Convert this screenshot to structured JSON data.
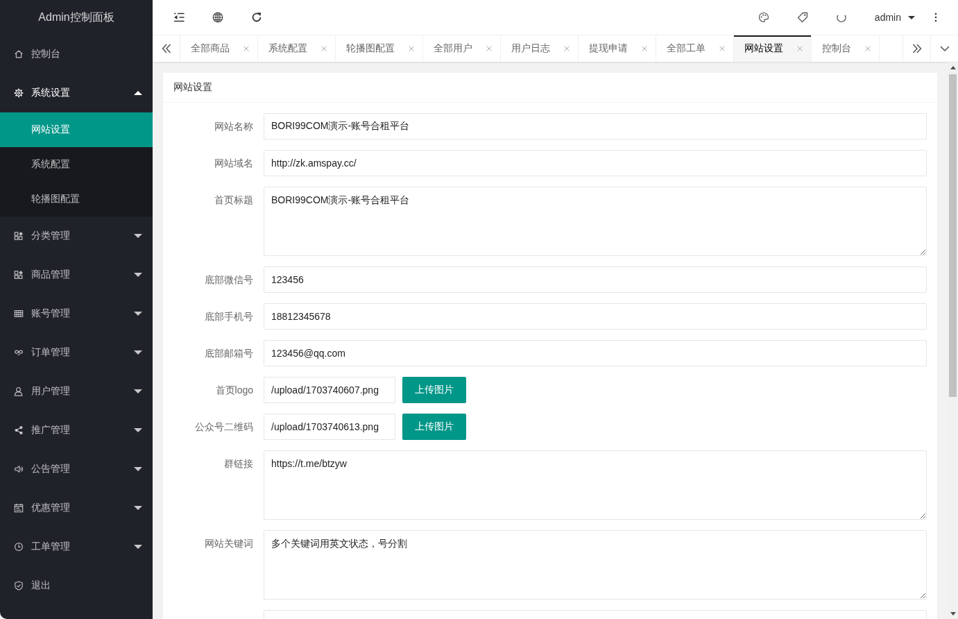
{
  "sidebar": {
    "title": "Admin控制面板",
    "items": [
      {
        "kind": "link",
        "label": "控制台",
        "selected": false
      },
      {
        "kind": "group",
        "label": "系统设置",
        "selected": false,
        "expanded": true,
        "children": [
          {
            "label": "网站设置",
            "selected": true
          },
          {
            "label": "系统配置",
            "selected": false
          },
          {
            "label": "轮播图配置",
            "selected": false
          }
        ]
      },
      {
        "kind": "group",
        "label": "分类管理",
        "selected": false,
        "expanded": false
      },
      {
        "kind": "group",
        "label": "商品管理",
        "selected": false,
        "expanded": false
      },
      {
        "kind": "group",
        "label": "账号管理",
        "selected": false,
        "expanded": false
      },
      {
        "kind": "group",
        "label": "订单管理",
        "selected": false,
        "expanded": false
      },
      {
        "kind": "group",
        "label": "用户管理",
        "selected": false,
        "expanded": false
      },
      {
        "kind": "group",
        "label": "推广管理",
        "selected": false,
        "expanded": false
      },
      {
        "kind": "group",
        "label": "公告管理",
        "selected": false,
        "expanded": false
      },
      {
        "kind": "group",
        "label": "优惠管理",
        "selected": false,
        "expanded": false
      },
      {
        "kind": "group",
        "label": "工单管理",
        "selected": false,
        "expanded": false
      },
      {
        "kind": "link",
        "label": "退出",
        "selected": false
      }
    ]
  },
  "header": {
    "user": "admin"
  },
  "tabs": [
    {
      "label": "全部商品",
      "selected": false
    },
    {
      "label": "系统配置",
      "selected": false
    },
    {
      "label": "轮播图配置",
      "selected": false
    },
    {
      "label": "全部用户",
      "selected": false
    },
    {
      "label": "用户日志",
      "selected": false
    },
    {
      "label": "提现申请",
      "selected": false
    },
    {
      "label": "全部工单",
      "selected": false
    },
    {
      "label": "网站设置",
      "selected": true
    },
    {
      "label": "控制台",
      "selected": false
    }
  ],
  "form": {
    "title": "网站设置",
    "fields": [
      {
        "kind": "input",
        "label": "网站名称",
        "value": "BORI99COM演示-账号合租平台"
      },
      {
        "kind": "input",
        "label": "网站域名",
        "value": "http://zk.amspay.cc/"
      },
      {
        "kind": "textarea",
        "label": "首页标题",
        "value": "BORI99COM演示-账号合租平台"
      },
      {
        "kind": "input",
        "label": "底部微信号",
        "value": "123456"
      },
      {
        "kind": "input",
        "label": "底部手机号",
        "value": "18812345678"
      },
      {
        "kind": "input",
        "label": "底部邮箱号",
        "value": "123456@qq.com"
      },
      {
        "kind": "upload",
        "label": "首页logo",
        "value": "/upload/1703740607.png",
        "button": "上传图片"
      },
      {
        "kind": "upload",
        "label": "公众号二维码",
        "value": "/upload/1703740613.png",
        "button": "上传图片"
      },
      {
        "kind": "textarea",
        "label": "群链接",
        "value": "https://t.me/btzyw"
      },
      {
        "kind": "textarea",
        "label": "网站关键词",
        "value": "多个关键词用英文状态，号分割"
      },
      {
        "kind": "textarea"
      }
    ]
  }
}
